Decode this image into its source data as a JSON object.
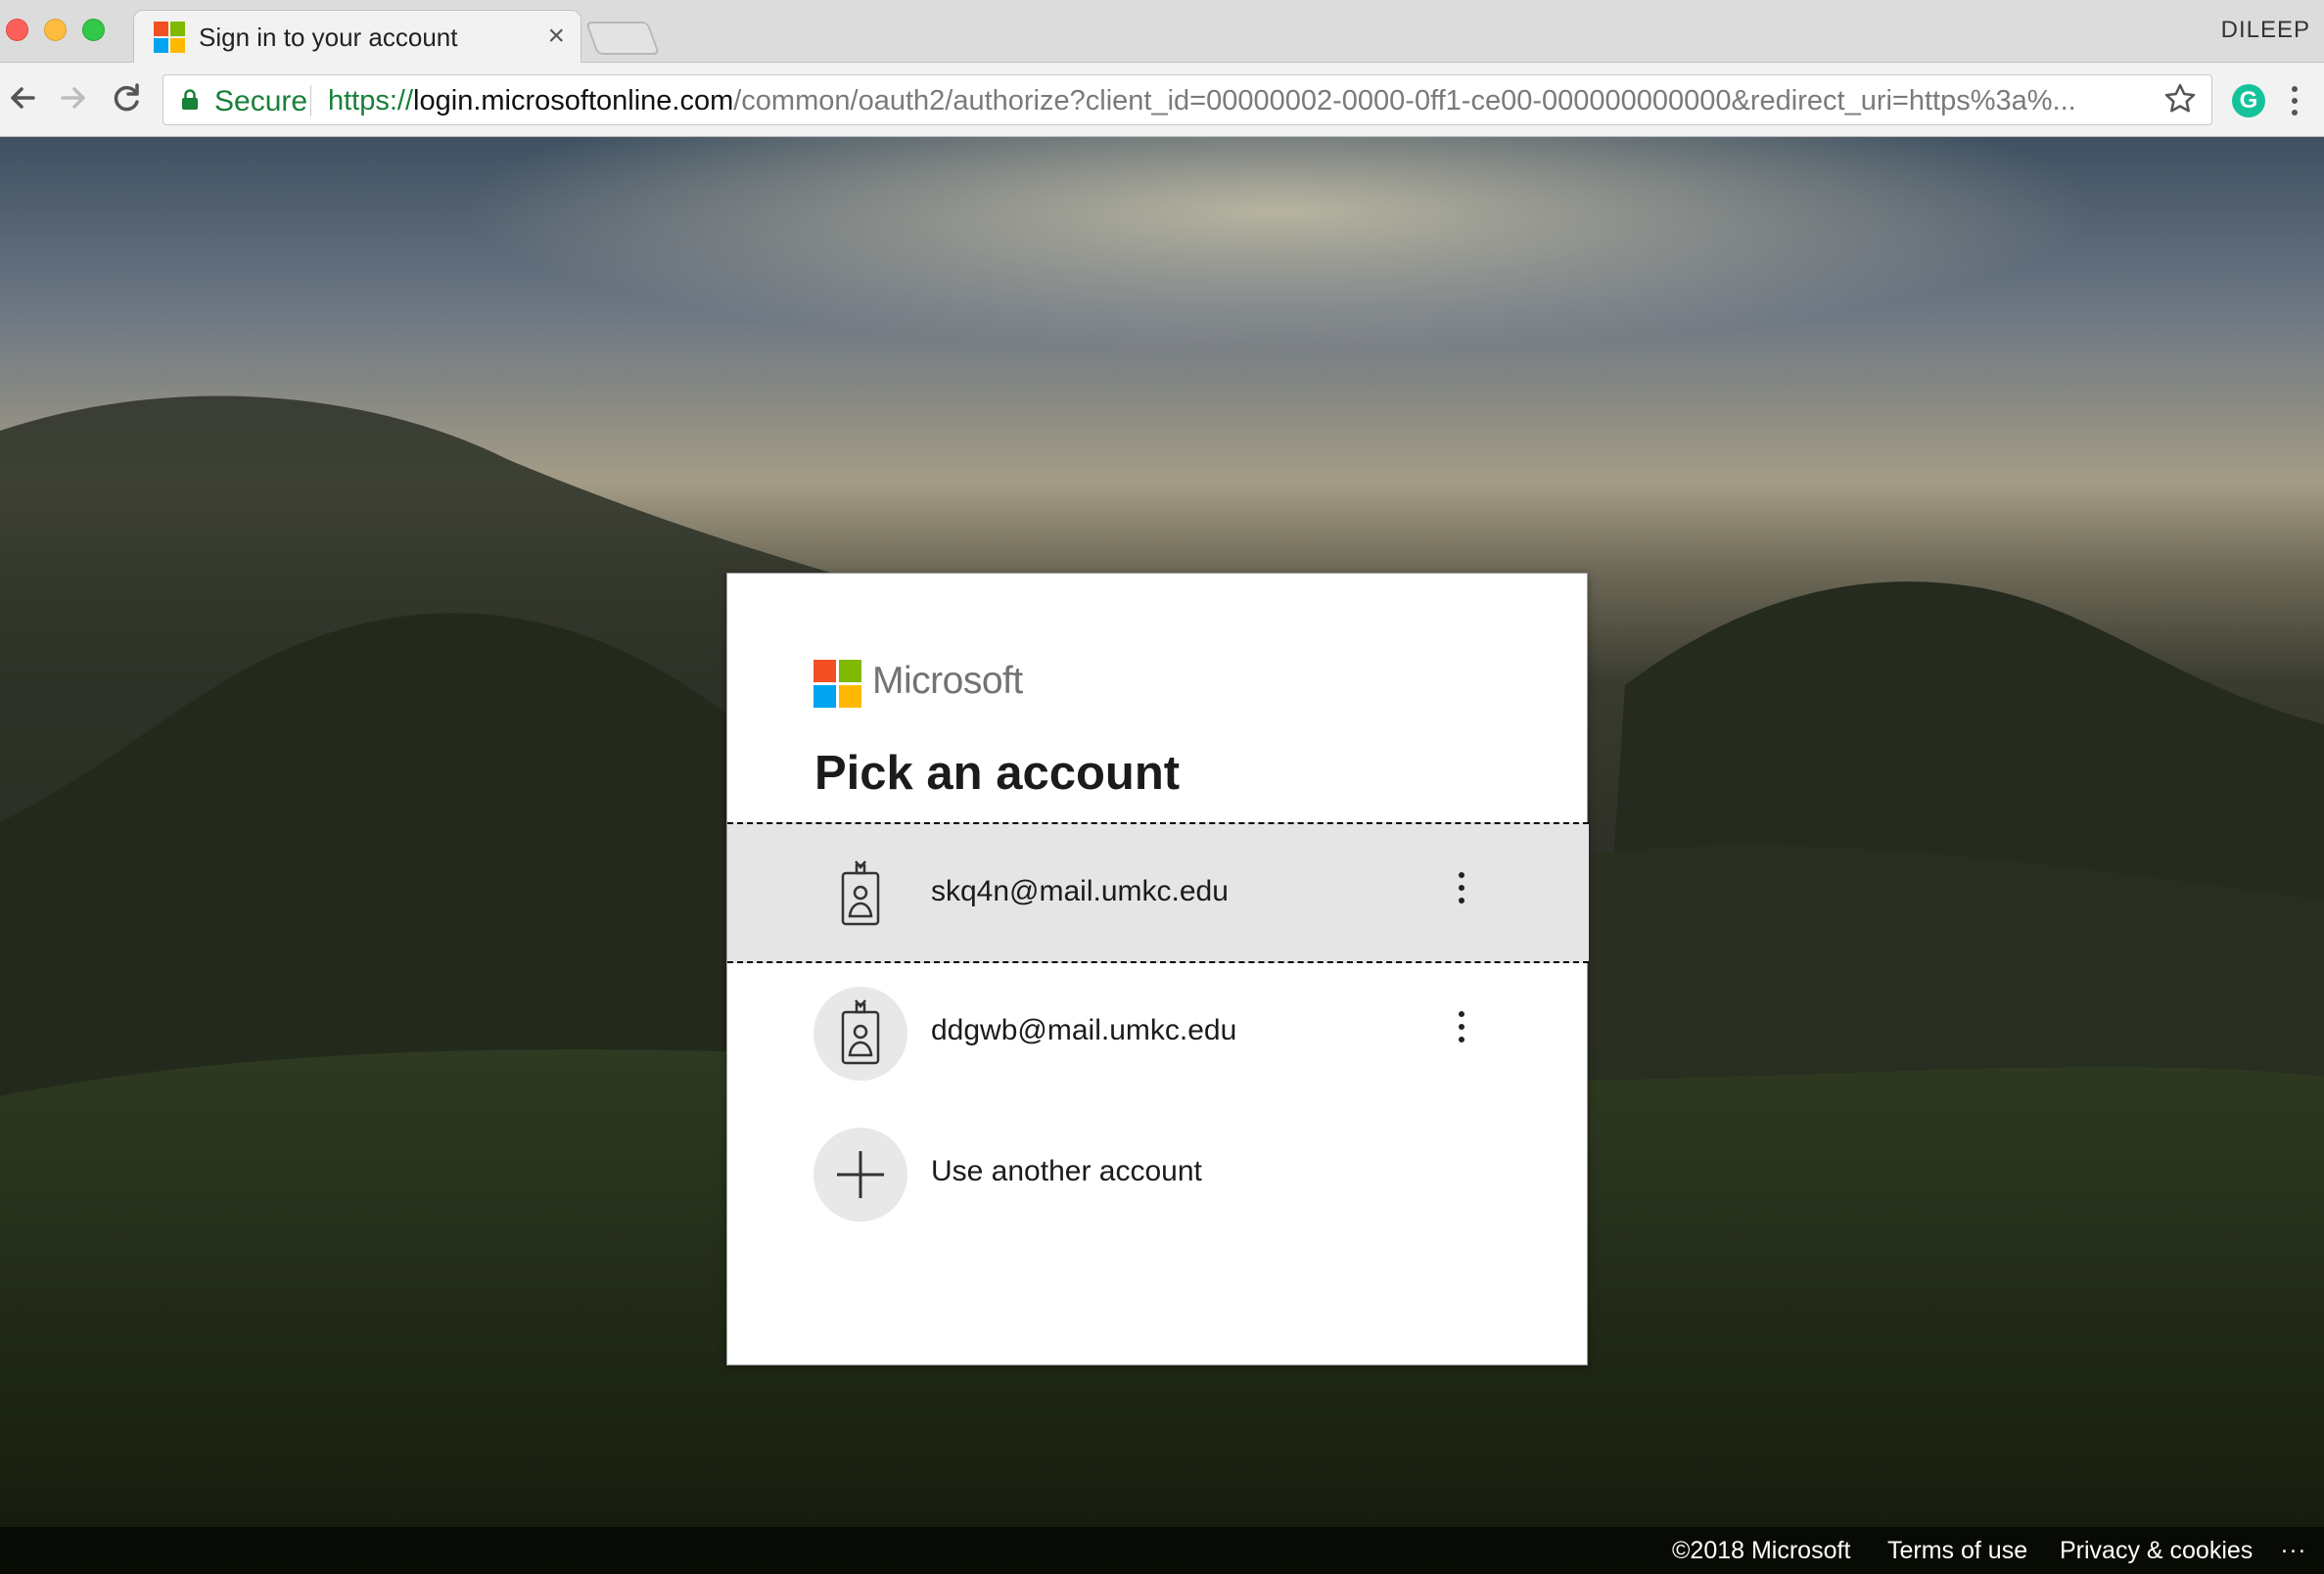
{
  "browser": {
    "tab_title": "Sign in to your account",
    "tab_close": "×",
    "profile_name": "DILEEP",
    "secure_label": "Secure",
    "url_scheme": "https://",
    "url_host": "login.microsoftonline.com",
    "url_path": "/common/oauth2/authorize?client_id=00000002-0000-0ff1-ce00-000000000000&redirect_uri=https%3a%...",
    "extension_label": "G"
  },
  "dialog": {
    "brand": "Microsoft",
    "title": "Pick an account",
    "accounts": [
      {
        "email": "skq4n@mail.umkc.edu",
        "selected": true
      },
      {
        "email": "ddgwb@mail.umkc.edu",
        "selected": false
      }
    ],
    "use_another": "Use another account"
  },
  "footer": {
    "copyright": "©2018 Microsoft",
    "terms": "Terms of use",
    "privacy": "Privacy & cookies",
    "more": "..."
  },
  "colors": {
    "ms_red": "#f25022",
    "ms_green": "#7fba00",
    "ms_blue": "#00a4ef",
    "ms_yellow": "#ffb900",
    "secure_green": "#188038"
  }
}
